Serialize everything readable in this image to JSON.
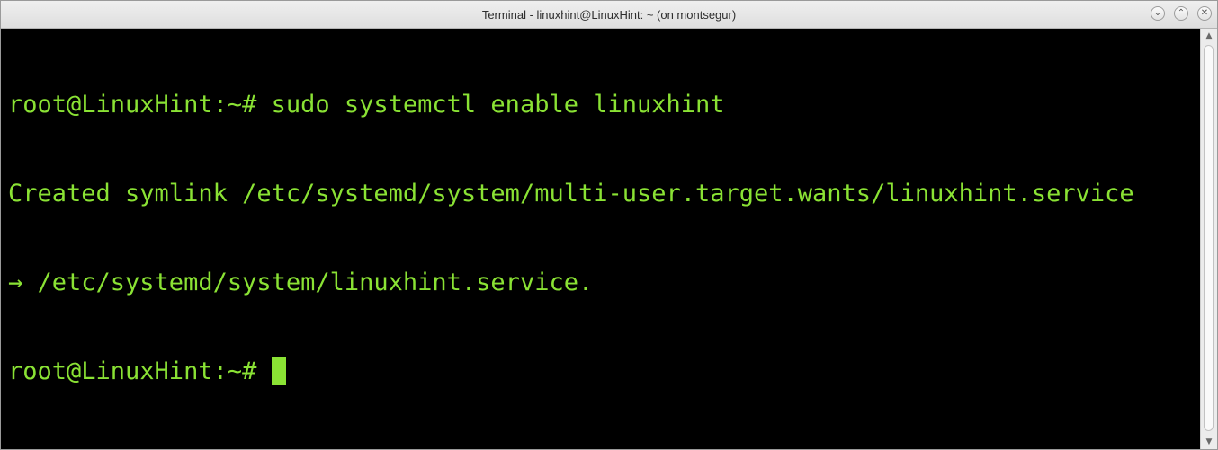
{
  "window": {
    "title": "Terminal - linuxhint@LinuxHint: ~ (on montsegur)",
    "buttons": {
      "minimize_icon": "chevron-down-icon",
      "maximize_icon": "chevron-up-icon",
      "close_icon": "close-icon",
      "minimize_glyph": "⌄",
      "maximize_glyph": "⌃",
      "close_glyph": "✕"
    }
  },
  "terminal": {
    "colors": {
      "background": "#000000",
      "foreground": "#8ae234"
    },
    "lines": [
      "root@LinuxHint:~# sudo systemctl enable linuxhint",
      "Created symlink /etc/systemd/system/multi-user.target.wants/linuxhint.service",
      "→ /etc/systemd/system/linuxhint.service.",
      "root@LinuxHint:~# "
    ]
  },
  "scrollbar": {
    "up_glyph": "▲",
    "down_glyph": "▼"
  }
}
